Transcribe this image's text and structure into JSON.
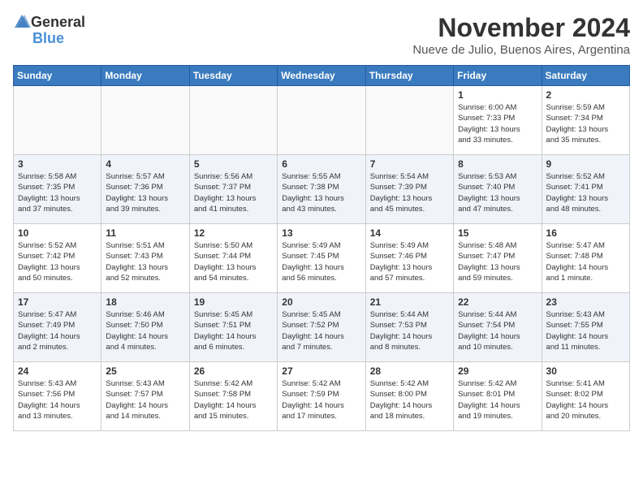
{
  "logo": {
    "general": "General",
    "blue": "Blue"
  },
  "title": "November 2024",
  "location": "Nueve de Julio, Buenos Aires, Argentina",
  "days_header": [
    "Sunday",
    "Monday",
    "Tuesday",
    "Wednesday",
    "Thursday",
    "Friday",
    "Saturday"
  ],
  "weeks": [
    [
      {
        "day": "",
        "info": ""
      },
      {
        "day": "",
        "info": ""
      },
      {
        "day": "",
        "info": ""
      },
      {
        "day": "",
        "info": ""
      },
      {
        "day": "",
        "info": ""
      },
      {
        "day": "1",
        "info": "Sunrise: 6:00 AM\nSunset: 7:33 PM\nDaylight: 13 hours\nand 33 minutes."
      },
      {
        "day": "2",
        "info": "Sunrise: 5:59 AM\nSunset: 7:34 PM\nDaylight: 13 hours\nand 35 minutes."
      }
    ],
    [
      {
        "day": "3",
        "info": "Sunrise: 5:58 AM\nSunset: 7:35 PM\nDaylight: 13 hours\nand 37 minutes."
      },
      {
        "day": "4",
        "info": "Sunrise: 5:57 AM\nSunset: 7:36 PM\nDaylight: 13 hours\nand 39 minutes."
      },
      {
        "day": "5",
        "info": "Sunrise: 5:56 AM\nSunset: 7:37 PM\nDaylight: 13 hours\nand 41 minutes."
      },
      {
        "day": "6",
        "info": "Sunrise: 5:55 AM\nSunset: 7:38 PM\nDaylight: 13 hours\nand 43 minutes."
      },
      {
        "day": "7",
        "info": "Sunrise: 5:54 AM\nSunset: 7:39 PM\nDaylight: 13 hours\nand 45 minutes."
      },
      {
        "day": "8",
        "info": "Sunrise: 5:53 AM\nSunset: 7:40 PM\nDaylight: 13 hours\nand 47 minutes."
      },
      {
        "day": "9",
        "info": "Sunrise: 5:52 AM\nSunset: 7:41 PM\nDaylight: 13 hours\nand 48 minutes."
      }
    ],
    [
      {
        "day": "10",
        "info": "Sunrise: 5:52 AM\nSunset: 7:42 PM\nDaylight: 13 hours\nand 50 minutes."
      },
      {
        "day": "11",
        "info": "Sunrise: 5:51 AM\nSunset: 7:43 PM\nDaylight: 13 hours\nand 52 minutes."
      },
      {
        "day": "12",
        "info": "Sunrise: 5:50 AM\nSunset: 7:44 PM\nDaylight: 13 hours\nand 54 minutes."
      },
      {
        "day": "13",
        "info": "Sunrise: 5:49 AM\nSunset: 7:45 PM\nDaylight: 13 hours\nand 56 minutes."
      },
      {
        "day": "14",
        "info": "Sunrise: 5:49 AM\nSunset: 7:46 PM\nDaylight: 13 hours\nand 57 minutes."
      },
      {
        "day": "15",
        "info": "Sunrise: 5:48 AM\nSunset: 7:47 PM\nDaylight: 13 hours\nand 59 minutes."
      },
      {
        "day": "16",
        "info": "Sunrise: 5:47 AM\nSunset: 7:48 PM\nDaylight: 14 hours\nand 1 minute."
      }
    ],
    [
      {
        "day": "17",
        "info": "Sunrise: 5:47 AM\nSunset: 7:49 PM\nDaylight: 14 hours\nand 2 minutes."
      },
      {
        "day": "18",
        "info": "Sunrise: 5:46 AM\nSunset: 7:50 PM\nDaylight: 14 hours\nand 4 minutes."
      },
      {
        "day": "19",
        "info": "Sunrise: 5:45 AM\nSunset: 7:51 PM\nDaylight: 14 hours\nand 6 minutes."
      },
      {
        "day": "20",
        "info": "Sunrise: 5:45 AM\nSunset: 7:52 PM\nDaylight: 14 hours\nand 7 minutes."
      },
      {
        "day": "21",
        "info": "Sunrise: 5:44 AM\nSunset: 7:53 PM\nDaylight: 14 hours\nand 8 minutes."
      },
      {
        "day": "22",
        "info": "Sunrise: 5:44 AM\nSunset: 7:54 PM\nDaylight: 14 hours\nand 10 minutes."
      },
      {
        "day": "23",
        "info": "Sunrise: 5:43 AM\nSunset: 7:55 PM\nDaylight: 14 hours\nand 11 minutes."
      }
    ],
    [
      {
        "day": "24",
        "info": "Sunrise: 5:43 AM\nSunset: 7:56 PM\nDaylight: 14 hours\nand 13 minutes."
      },
      {
        "day": "25",
        "info": "Sunrise: 5:43 AM\nSunset: 7:57 PM\nDaylight: 14 hours\nand 14 minutes."
      },
      {
        "day": "26",
        "info": "Sunrise: 5:42 AM\nSunset: 7:58 PM\nDaylight: 14 hours\nand 15 minutes."
      },
      {
        "day": "27",
        "info": "Sunrise: 5:42 AM\nSunset: 7:59 PM\nDaylight: 14 hours\nand 17 minutes."
      },
      {
        "day": "28",
        "info": "Sunrise: 5:42 AM\nSunset: 8:00 PM\nDaylight: 14 hours\nand 18 minutes."
      },
      {
        "day": "29",
        "info": "Sunrise: 5:42 AM\nSunset: 8:01 PM\nDaylight: 14 hours\nand 19 minutes."
      },
      {
        "day": "30",
        "info": "Sunrise: 5:41 AM\nSunset: 8:02 PM\nDaylight: 14 hours\nand 20 minutes."
      }
    ]
  ]
}
